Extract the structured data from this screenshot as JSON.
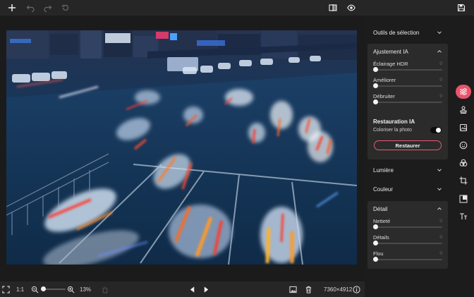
{
  "toolbar": {
    "add_icon": "plus-icon",
    "undo_icon": "undo-icon",
    "redo_icon": "redo-icon",
    "reset_icon": "reset-icon",
    "compare_icon": "split-view-icon",
    "preview_icon": "eye-icon",
    "save_icon": "save-icon"
  },
  "bottom": {
    "fit_icon": "fit-screen-icon",
    "ratio_label": "1:1",
    "zoom_out_icon": "zoom-out-icon",
    "zoom_in_icon": "zoom-in-icon",
    "zoom_level": "13%",
    "zoom_fraction": 0.13,
    "hand_icon": "hand-icon",
    "prev_icon": "prev-arrow-icon",
    "next_icon": "next-arrow-icon",
    "gallery_icon": "image-icon",
    "delete_icon": "trash-icon",
    "dimensions": "7360×4912",
    "info_icon": "info-icon"
  },
  "panel": {
    "selection_tools": "Outils de sélection",
    "ai_adjust": {
      "title": "Ajustement IA",
      "sliders": [
        {
          "label": "Éclairage HDR",
          "value": "0"
        },
        {
          "label": "Améliorer",
          "value": "0"
        },
        {
          "label": "Débruiter",
          "value": "0"
        }
      ]
    },
    "ai_restore": {
      "title": "Restauration IA",
      "colorize_label": "Coloriser la photo",
      "colorize_on": false,
      "button": "Restaurer"
    },
    "light": "Lumière",
    "color": "Couleur",
    "detail": {
      "title": "Détail",
      "sliders": [
        {
          "label": "Netteté",
          "value": "0"
        },
        {
          "label": "Détails",
          "value": "0"
        },
        {
          "label": "Flou",
          "value": "0"
        }
      ]
    }
  },
  "rail": {
    "items": [
      "adjust-sliders-icon",
      "stamp-icon",
      "image-layers-icon",
      "face-icon",
      "color-circles-icon",
      "crop-icon",
      "resize-icon",
      "text-icon"
    ],
    "accent": "#e8546c"
  },
  "colors": {
    "accent": "#e8546c",
    "panel_bg": "#2b2b2b",
    "app_bg": "#1c1c1c"
  }
}
